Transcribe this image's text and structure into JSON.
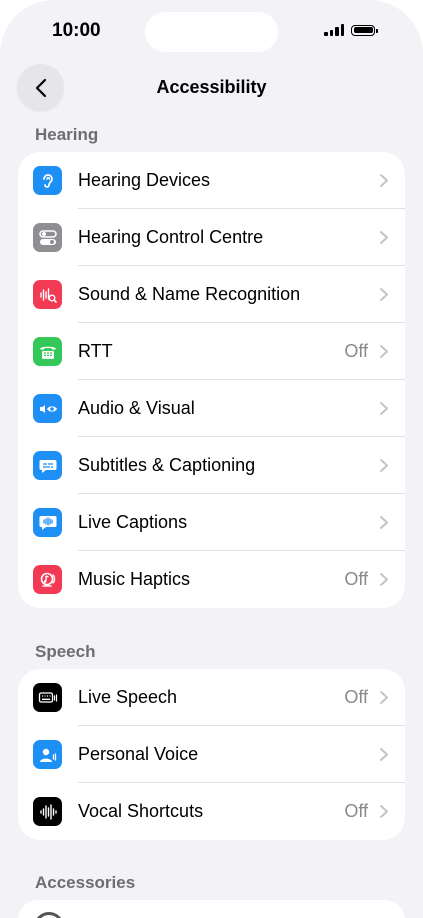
{
  "status": {
    "time": "10:00"
  },
  "nav": {
    "title": "Accessibility"
  },
  "sections": {
    "hearing": {
      "header": "Hearing",
      "items": [
        {
          "label": "Hearing Devices",
          "value": "",
          "color": "#1e8ff5",
          "icon": "ear-icon"
        },
        {
          "label": "Hearing Control Centre",
          "value": "",
          "color": "#8e8e93",
          "icon": "toggles-icon"
        },
        {
          "label": "Sound & Name Recognition",
          "value": "",
          "color": "#f23a55",
          "icon": "waveform-search-icon"
        },
        {
          "label": "RTT",
          "value": "Off",
          "color": "#34c759",
          "icon": "tty-icon"
        },
        {
          "label": "Audio & Visual",
          "value": "",
          "color": "#1e8ff5",
          "icon": "speaker-eye-icon"
        },
        {
          "label": "Subtitles & Captioning",
          "value": "",
          "color": "#1e8ff5",
          "icon": "captions-bubble-icon"
        },
        {
          "label": "Live Captions",
          "value": "",
          "color": "#1e8ff5",
          "icon": "live-captions-icon"
        },
        {
          "label": "Music Haptics",
          "value": "Off",
          "color": "#f23a55",
          "icon": "music-haptics-icon"
        }
      ]
    },
    "speech": {
      "header": "Speech",
      "items": [
        {
          "label": "Live Speech",
          "value": "Off",
          "color": "#000000",
          "icon": "keyboard-speech-icon"
        },
        {
          "label": "Personal Voice",
          "value": "",
          "color": "#1e8ff5",
          "icon": "person-voice-icon"
        },
        {
          "label": "Vocal Shortcuts",
          "value": "Off",
          "color": "#000000",
          "icon": "waveform-icon"
        }
      ]
    },
    "accessories": {
      "header": "Accessories"
    }
  }
}
